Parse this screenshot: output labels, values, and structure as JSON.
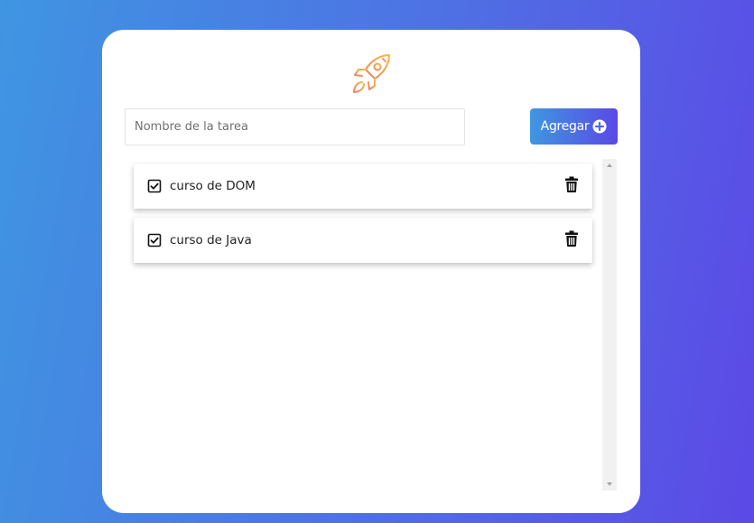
{
  "app": {
    "logo_icon": "rocket-icon",
    "accent_gradient": [
      "#3f97e0",
      "#5a49e6"
    ],
    "logo_gradient": [
      "#f4b942",
      "#ef7f63"
    ]
  },
  "form": {
    "input_placeholder": "Nombre de la tarea",
    "input_value": "",
    "add_button_label": "Agregar",
    "add_button_icon": "plus-circle-icon"
  },
  "tasks": [
    {
      "text": "curso de DOM",
      "checked": true,
      "delete_icon": "trash-icon"
    },
    {
      "text": "curso de Java",
      "checked": true,
      "delete_icon": "trash-icon"
    }
  ]
}
